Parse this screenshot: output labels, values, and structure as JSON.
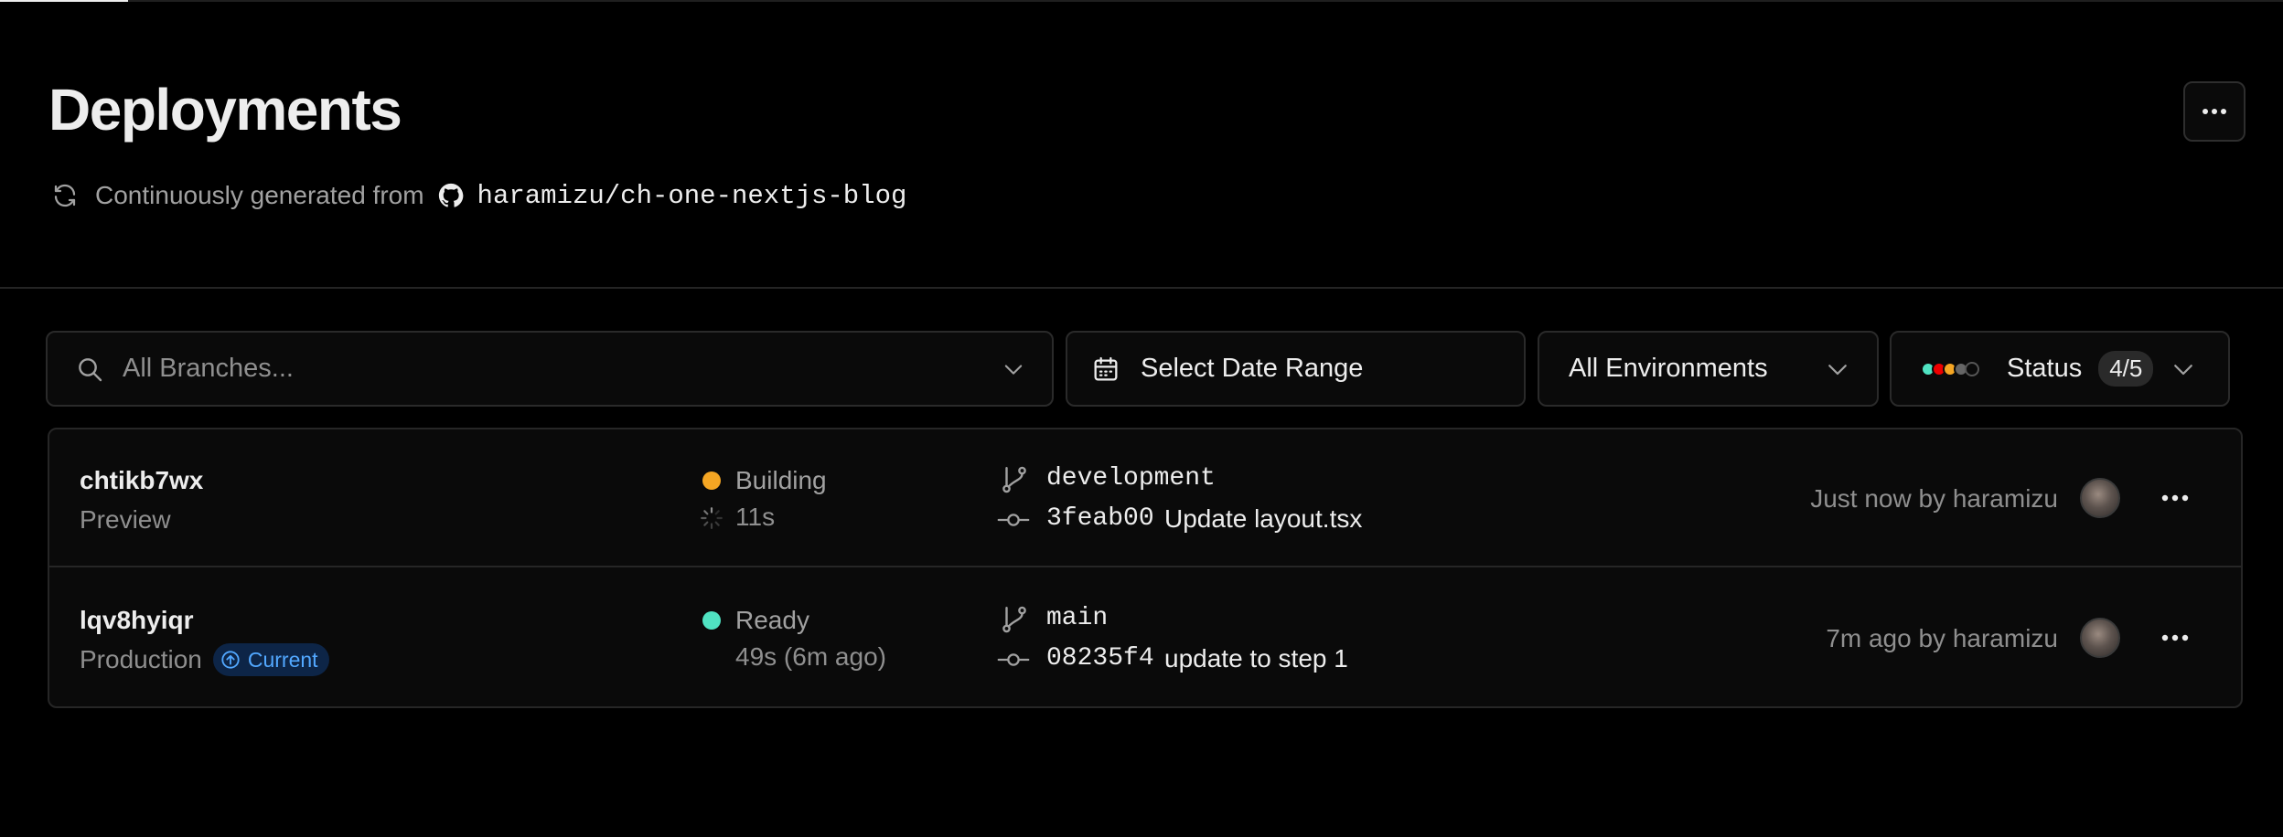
{
  "page": {
    "title": "Deployments",
    "subtitle_prefix": "Continuously generated from",
    "repo": "haramizu/ch-one-nextjs-blog",
    "progress_fraction": 0.056
  },
  "filters": {
    "branch_placeholder": "All Branches...",
    "date_label": "Select Date Range",
    "environment_label": "All Environments",
    "status_label": "Status",
    "status_count": "4/5"
  },
  "colors": {
    "background": "#000000",
    "building": "#f5a623",
    "ready": "#50e3c2",
    "current_badge_bg": "#0d2547",
    "current_badge_text": "#52a8ff",
    "status_dots": [
      "#50e3c2",
      "#ee0000",
      "#f5a623",
      "#666666",
      "#333333"
    ]
  },
  "deployments": [
    {
      "id": "chtikb7wx",
      "environment": "Preview",
      "current_badge": "",
      "status": "Building",
      "duration": "11s",
      "branch": "development",
      "commit_sha": "3feab00",
      "commit_message": "Update layout.tsx",
      "meta": "Just now by haramizu"
    },
    {
      "id": "lqv8hyiqr",
      "environment": "Production",
      "current_badge": "Current",
      "status": "Ready",
      "duration": "49s (6m ago)",
      "branch": "main",
      "commit_sha": "08235f4",
      "commit_message": "update to step 1",
      "meta": "7m ago by haramizu"
    }
  ],
  "icons": {
    "menu": "ellipsis-icon",
    "sync": "refresh-icon",
    "repo": "github-icon",
    "search": "search-icon",
    "date": "calendar-icon",
    "dropdown": "chevron-down-icon",
    "branch": "git-branch-icon",
    "commit": "git-commit-icon",
    "current": "arrow-up-circle-icon"
  }
}
